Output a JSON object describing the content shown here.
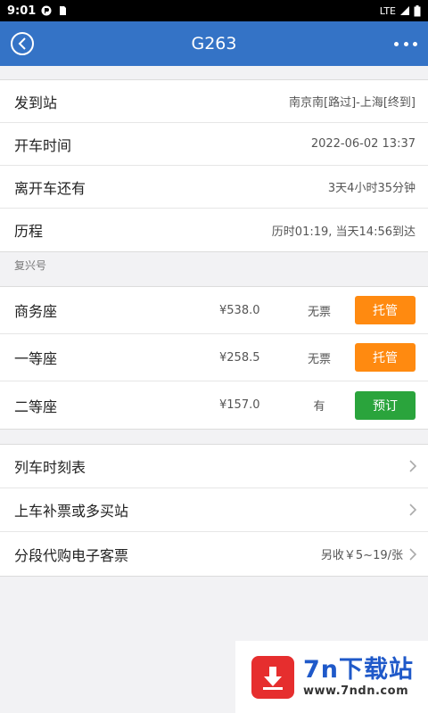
{
  "status_bar": {
    "time": "9:01",
    "network": "LTE"
  },
  "header": {
    "title": "G263"
  },
  "trip_info": [
    {
      "label": "发到站",
      "value": "南京南[路过]-上海[终到]"
    },
    {
      "label": "开车时间",
      "value": "2022-06-02 13:37"
    },
    {
      "label": "离开车还有",
      "value": "3天4小时35分钟"
    },
    {
      "label": "历程",
      "value": "历时01:19, 当天14:56到达"
    }
  ],
  "train_type": "复兴号",
  "seats": [
    {
      "label": "商务座",
      "price": "¥538.0",
      "availability": "无票",
      "action": "托管",
      "action_color": "#ff8a10"
    },
    {
      "label": "一等座",
      "price": "¥258.5",
      "availability": "无票",
      "action": "托管",
      "action_color": "#ff8a10"
    },
    {
      "label": "二等座",
      "price": "¥157.0",
      "availability": "有",
      "action": "预订",
      "action_color": "#2aa43c"
    }
  ],
  "links": [
    {
      "label": "列车时刻表",
      "note": ""
    },
    {
      "label": "上车补票或多买站",
      "note": ""
    },
    {
      "label": "分段代购电子客票",
      "note": "另收￥5~19/张"
    }
  ],
  "watermark": {
    "brand": "7n下载站",
    "url": "www.7ndn.com"
  },
  "colors": {
    "header": "#3473c6",
    "orange_button": "#ff8a10",
    "green_button": "#2aa43c"
  }
}
